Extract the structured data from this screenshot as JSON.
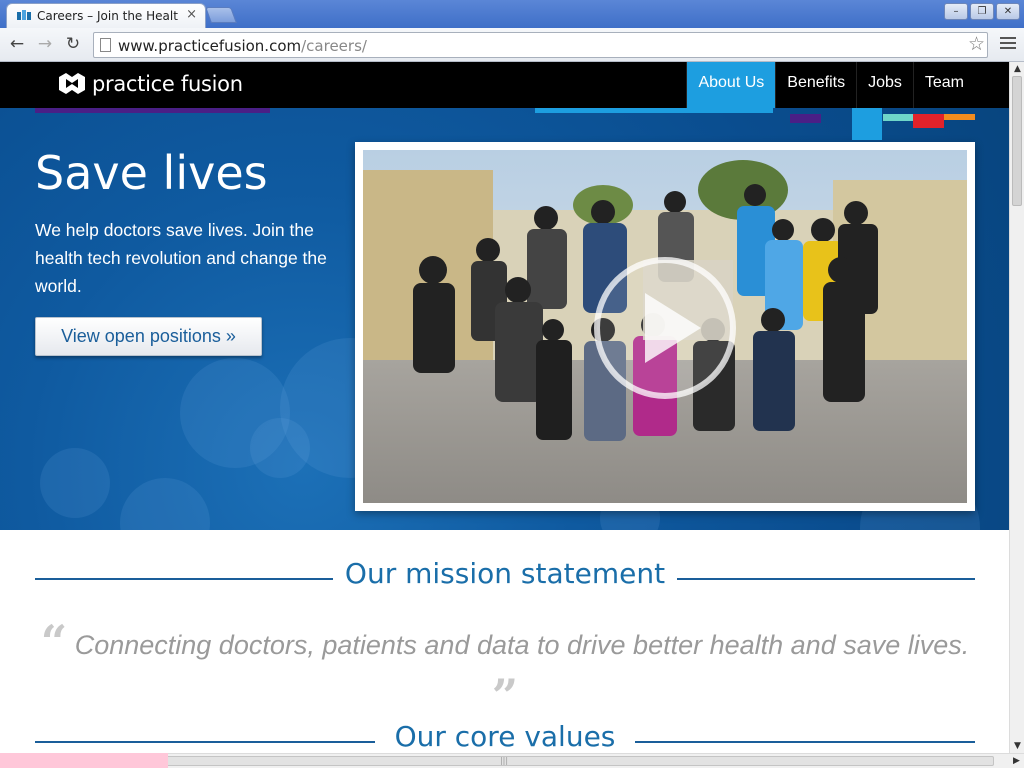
{
  "browser": {
    "tab_title": "Careers – Join the Healt",
    "tab_close": "×",
    "url_domain": "www.practicefusion.com",
    "url_path": "/careers/",
    "window_buttons": [
      "–",
      "❐",
      "✕"
    ]
  },
  "site": {
    "logo_text": "practice fusion",
    "nav": [
      {
        "label": "About Us",
        "active": true
      },
      {
        "label": "Benefits",
        "active": false
      },
      {
        "label": "Jobs",
        "active": false
      },
      {
        "label": "Team",
        "active": false
      }
    ]
  },
  "hero": {
    "title": "Save lives",
    "text": "We help doctors save lives. Join the health tech revolution and change the world.",
    "cta_label": "View open positions »"
  },
  "mission": {
    "heading": "Our mission statement",
    "quote": "Connecting doctors, patients and data to drive better health and save lives."
  },
  "core_values": {
    "heading": "Our core values"
  },
  "colors": {
    "header_bg": "#000000",
    "nav_active": "#1d9ee0",
    "hero_blue": "#0f5aa0",
    "heading_blue": "#1a6ea9",
    "quote_gray": "#9a9a9a"
  }
}
